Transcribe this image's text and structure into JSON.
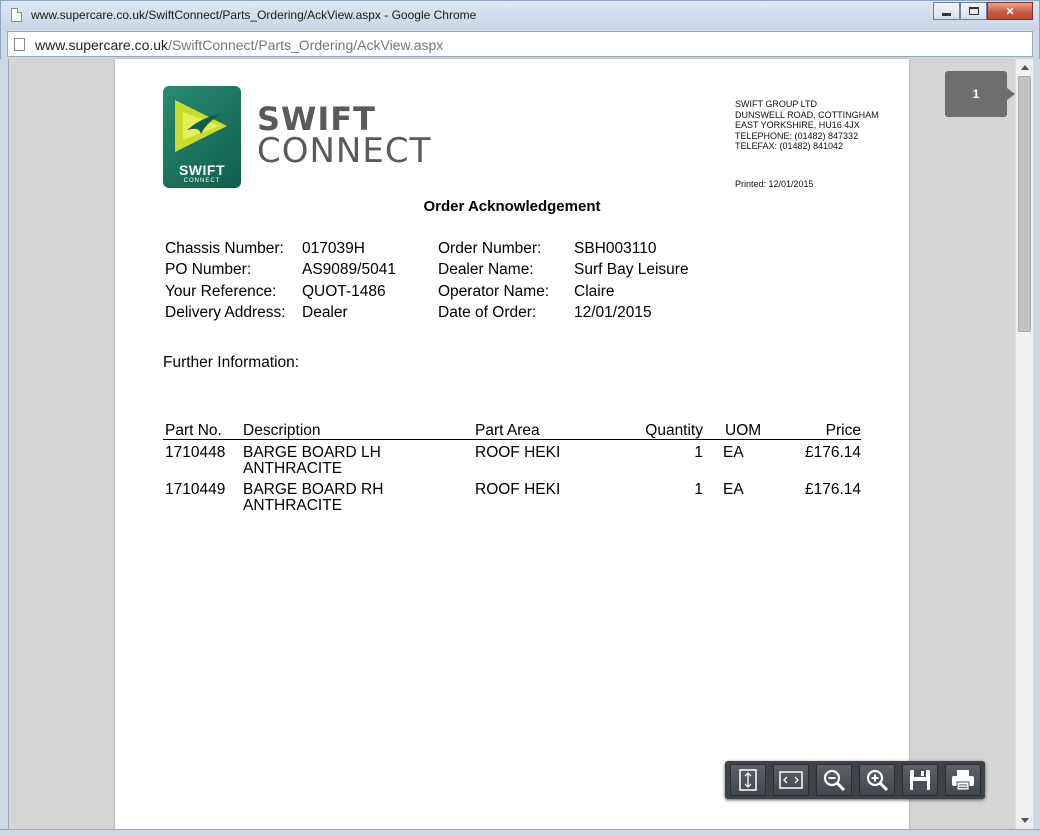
{
  "window": {
    "title": "www.supercare.co.uk/SwiftConnect/Parts_Ordering/AckView.aspx - Google Chrome",
    "url_host": "www.supercare.co.uk",
    "url_path": "/SwiftConnect/Parts_Ordering/AckView.aspx",
    "buttons": {
      "minimize": "minimize",
      "maximize": "maximize",
      "close": "✕"
    }
  },
  "document": {
    "logo": {
      "badge": "SWIFT",
      "badge_sub": "CONNECT",
      "word1": "SWIFT",
      "word2": "CONNECT"
    },
    "company": {
      "lines": [
        "SWIFT GROUP LTD",
        "DUNSWELL ROAD, COTTINGHAM",
        "EAST YORKSHIRE, HU16 4JX",
        "TELEPHONE: (01482) 847332",
        "TELEFAX: (01482) 841042"
      ],
      "printed": "Printed: 12/01/2015"
    },
    "title": "Order Acknowledgement",
    "fields_left": [
      {
        "label": "Chassis Number:",
        "value": "017039H"
      },
      {
        "label": "PO Number:",
        "value": "AS9089/5041"
      },
      {
        "label": "Your Reference:",
        "value": "QUOT-1486"
      },
      {
        "label": "Delivery Address:",
        "value": "Dealer"
      }
    ],
    "fields_right": [
      {
        "label": "Order Number:",
        "value": "SBH003110"
      },
      {
        "label": "Dealer Name:",
        "value": "Surf Bay Leisure"
      },
      {
        "label": "Operator Name:",
        "value": "Claire"
      },
      {
        "label": "Date of Order:",
        "value": "12/01/2015"
      }
    ],
    "further_info": "Further Information:",
    "table": {
      "headers": {
        "part": "Part No.",
        "desc": "Description",
        "area": "Part Area",
        "qty": "Quantity",
        "uom": "UOM",
        "price": "Price"
      },
      "rows": [
        {
          "part": "1710448",
          "desc1": "BARGE BOARD LH",
          "desc2": "ANTHRACITE",
          "area": "ROOF HEKI",
          "qty": "1",
          "uom": "EA",
          "price": "£176.14"
        },
        {
          "part": "1710449",
          "desc1": "BARGE BOARD RH",
          "desc2": "ANTHRACITE",
          "area": "ROOF HEKI",
          "qty": "1",
          "uom": "EA",
          "price": "£176.14"
        }
      ]
    }
  },
  "viewer": {
    "page_indicator": "1",
    "tools": [
      "fit-page-icon",
      "fit-width-icon",
      "zoom-out-icon",
      "zoom-in-icon",
      "save-icon",
      "print-icon"
    ]
  }
}
